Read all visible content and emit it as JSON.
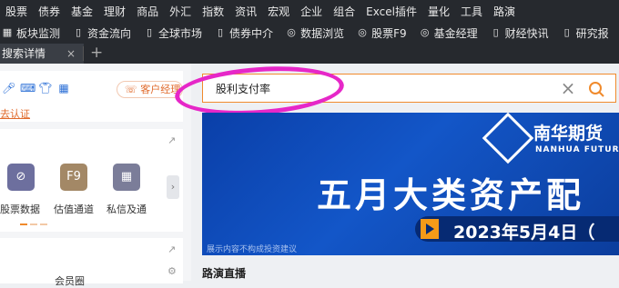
{
  "menubar": [
    "股票",
    "债券",
    "基金",
    "理财",
    "商品",
    "外汇",
    "指数",
    "资讯",
    "宏观",
    "企业",
    "组合",
    "Excel插件",
    "量化",
    "工具",
    "路演"
  ],
  "toolbar": [
    {
      "label": "板块监测",
      "icon": "grid-icon"
    },
    {
      "label": "资金流向",
      "icon": "clipboard-icon"
    },
    {
      "label": "全球市场",
      "icon": "clipboard-icon"
    },
    {
      "label": "债券中介",
      "icon": "clipboard-icon"
    },
    {
      "label": "数据浏览",
      "icon": "globe-icon"
    },
    {
      "label": "股票F9",
      "icon": "globe-icon"
    },
    {
      "label": "基金经理",
      "icon": "globe-icon"
    },
    {
      "label": "财经快讯",
      "icon": "clipboard-icon"
    },
    {
      "label": "研究报",
      "icon": "clipboard-icon"
    }
  ],
  "tabs": {
    "active_label": "搜索详情",
    "close": "×",
    "add": "+"
  },
  "left": {
    "service_pill": "客户经理",
    "verify_link": "去认证",
    "apps": [
      {
        "label": "股票数据",
        "icon": "planet-icon",
        "color": "#6d6f9e"
      },
      {
        "label": "估值通道",
        "icon": "f9-icon",
        "color": "#a38866"
      },
      {
        "label": "私信及通",
        "icon": "apps-icon",
        "color": "#7b7d99"
      }
    ],
    "arrow": "›",
    "bottom_label": "会员圈"
  },
  "search": {
    "value": "股利支付率",
    "placeholder": ""
  },
  "banner": {
    "brand_cn": "南华期货",
    "brand_en": "NANHUA FUTURES",
    "headline": "五月大类资产配",
    "date": "2023年5月4日（",
    "disclaimer": "展示内容不构成投资建议"
  },
  "section_title": "路演直播",
  "colors": {
    "accent": "#f08a2c",
    "annotation": "#e627c8",
    "banner": "#1356c8"
  }
}
